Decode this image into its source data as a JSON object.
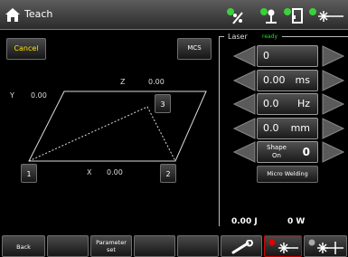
{
  "titlebar": {
    "title": "Teach",
    "home_icon": "home-icon",
    "status_icons": [
      "laser-ok-icon",
      "operator-ok-icon",
      "door-status-icon",
      "laser-emission-icon"
    ]
  },
  "toolbar": {
    "cancel_label": "Cancel",
    "mcs_label": "MCS"
  },
  "coordinates": {
    "z_axis": "Z",
    "z_value": "0.00",
    "y_axis": "Y",
    "y_value": "0.00",
    "x_axis": "X",
    "x_value": "0.00"
  },
  "points": [
    "1",
    "2",
    "3"
  ],
  "laser": {
    "title": "Laser",
    "status": "ready",
    "params": [
      {
        "value": "0",
        "unit": ""
      },
      {
        "value": "0.00",
        "unit": "ms"
      },
      {
        "value": "0.0",
        "unit": "Hz"
      },
      {
        "value": "0.0",
        "unit": "mm"
      }
    ],
    "shape": {
      "label_line1": "Shape",
      "label_line2": "On",
      "value": "0"
    },
    "micro_welding_label": "Micro Welding",
    "energy": "0.00 J",
    "power": "0 W"
  },
  "bottombar": {
    "back_label": "Back",
    "parameter_set_line1": "Parameter",
    "parameter_set_line2": "set"
  },
  "colors": {
    "cancel_text": "#ffe000",
    "ready_text": "#23e023",
    "arrow_fill": "#5a5a5a",
    "highlight_border": "#d40000"
  }
}
